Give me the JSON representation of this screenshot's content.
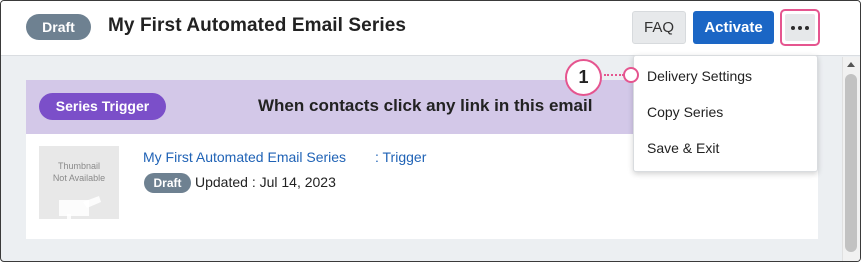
{
  "header": {
    "status_badge": "Draft",
    "title": "My First Automated Email Series",
    "faq_label": "FAQ",
    "activate_label": "Activate",
    "more_icon": "more-horizontal-icon"
  },
  "trigger": {
    "badge": "Series Trigger",
    "description": "When contacts click any link in this email"
  },
  "email_card": {
    "thumbnail_text_line1": "Thumbnail",
    "thumbnail_text_line2": "Not Available",
    "email_name": "My First Automated Email Series",
    "trigger_link": ": Trigger",
    "status_badge": "Draft",
    "updated": "Updated : Jul 14, 2023"
  },
  "dropdown_menu": {
    "items": [
      "Delivery Settings",
      "Copy Series",
      "Save & Exit"
    ]
  },
  "annotation": {
    "step_number": "1"
  },
  "colors": {
    "accent_blue": "#1b66c5",
    "trigger_purple": "#7b4fc9",
    "trigger_bar": "#d3c8e8",
    "draft_badge": "#6e8191",
    "highlight_pink": "#e5558f"
  }
}
